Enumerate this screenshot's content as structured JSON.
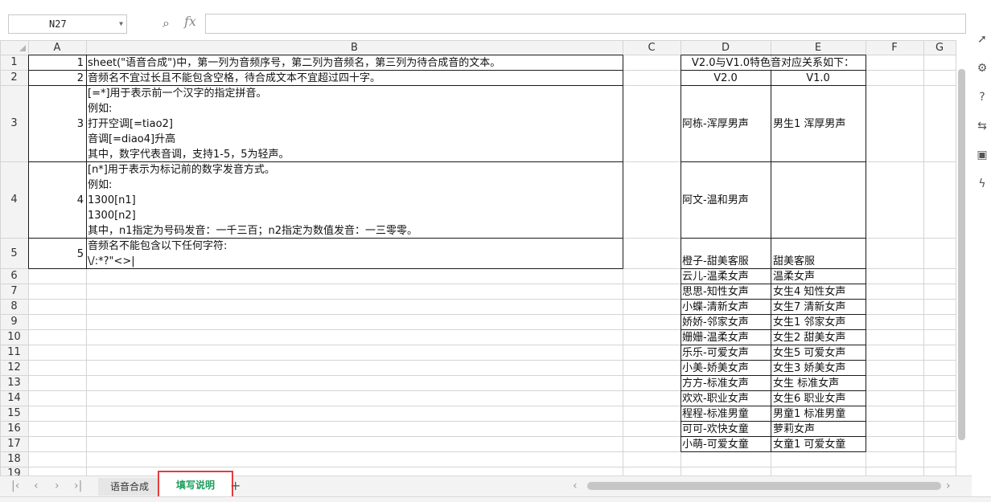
{
  "formula_bar": {
    "name_box": "N27",
    "fx_label": "fx",
    "formula_value": ""
  },
  "columns": [
    "A",
    "B",
    "C",
    "D",
    "E",
    "F",
    "G"
  ],
  "rows": [
    "1",
    "2",
    "3",
    "4",
    "5",
    "6",
    "7",
    "8",
    "9",
    "10",
    "11",
    "12",
    "13",
    "14",
    "15",
    "16",
    "17",
    "18",
    "19"
  ],
  "cells": {
    "A1": "1",
    "A2": "2",
    "A3": "3",
    "A4": "4",
    "A5": "5",
    "B1": "sheet(\"语音合成\")中，第一列为音频序号，第二列为音频名，第三列为待合成音的文本。",
    "B2": "音频名不宜过长且不能包含空格，待合成文本不宜超过四十字。",
    "B3": "[=*]用于表示前一个汉字的指定拼音。\n例如:\n打开空调[=tiao2]\n音调[=diao4]升高\n其中，数字代表音调，支持1-5，5为轻声。",
    "B4": "[n*]用于表示为标记前的数字发音方式。\n例如:\n1300[n1]\n1300[n2]\n其中，n1指定为号码发音：一千三百；n2指定为数值发音：一三零零。",
    "B5": "音频名不能包含以下任何字符:\n\\/:*?\"<>|",
    "D1E1": "V2.0与V1.0特色音对应关系如下：",
    "D2": "V2.0",
    "E2": "V1.0",
    "D3": "阿栋-浑厚男声",
    "E3": "男生1 浑厚男声",
    "D4": "阿文-温和男声",
    "E4": "",
    "D5": "橙子-甜美客服",
    "E5": "甜美客服",
    "D6": "云儿-温柔女声",
    "E6": "温柔女声",
    "D7": "思思-知性女声",
    "E7": "女生4 知性女声",
    "D8": "小蝶-清新女声",
    "E8": "女生7 清新女声",
    "D9": "娇娇-邻家女声",
    "E9": "女生1 邻家女声",
    "D10": "姗姗-温柔女声",
    "E10": "女生2 甜美女声",
    "D11": "乐乐-可爱女声",
    "E11": "女生5 可爱女声",
    "D12": "小美-娇美女声",
    "E12": "女生3 娇美女声",
    "D13": "方方-标准女声",
    "E13": "女生 标准女声",
    "D14": "欢欢-职业女声",
    "E14": "女生6 职业女声",
    "D15": "程程-标准男童",
    "E15": "男童1 标准男童",
    "D16": "可可-欢快女童",
    "E16": "萝莉女声",
    "D17": "小萌-可爱女童",
    "E17": "女童1 可爱女童"
  },
  "sheet_tabs": {
    "tab1": "语音合成",
    "tab2": "填写说明",
    "active": "填写说明"
  },
  "nav_icons": [
    "first-sheet-icon",
    "prev-sheet-icon",
    "next-sheet-icon",
    "last-sheet-icon"
  ],
  "sidebar_icons": [
    "pointer-icon",
    "settings-icon",
    "help-icon",
    "link-icon",
    "image-icon",
    "lightning-icon"
  ],
  "colors": {
    "active_tab_text": "#1c9d5b",
    "active_tab_outline": "#e63b3b",
    "grid_line": "#d4d4d4",
    "header_bg": "#f3f3f3"
  }
}
